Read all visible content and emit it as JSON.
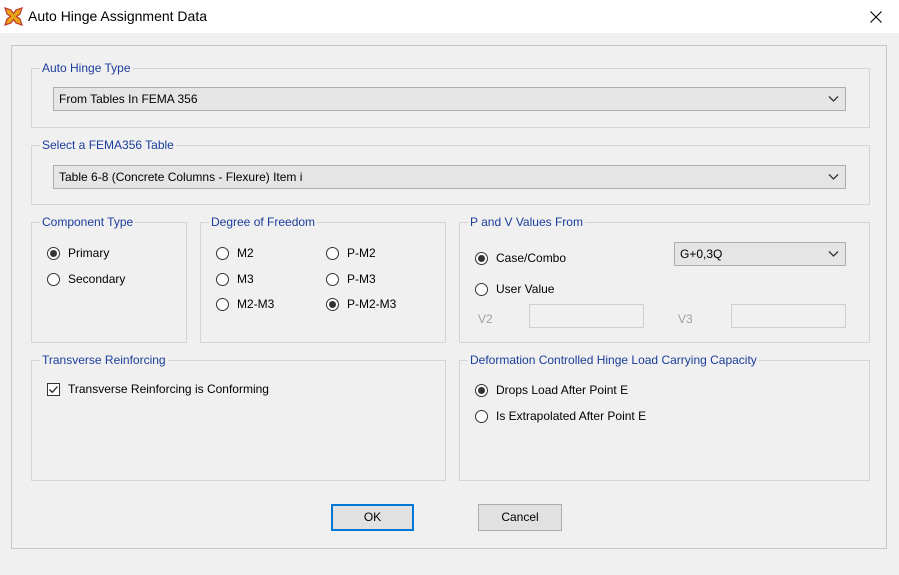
{
  "window": {
    "title": "Auto Hinge Assignment Data"
  },
  "auto_hinge_type": {
    "label": "Auto Hinge Type",
    "value": "From Tables In FEMA 356"
  },
  "fema_table": {
    "label": "Select a FEMA356 Table",
    "value": "Table 6-8 (Concrete Columns - Flexure) Item i"
  },
  "component_type": {
    "label": "Component Type",
    "options": [
      "Primary",
      "Secondary"
    ],
    "selected": "Primary"
  },
  "degree_of_freedom": {
    "label": "Degree of Freedom",
    "options": [
      "M2",
      "M3",
      "M2-M3",
      "P-M2",
      "P-M3",
      "P-M2-M3"
    ],
    "selected": "P-M2-M3"
  },
  "pv_values": {
    "label": "P and V Values From",
    "case_combo_label": "Case/Combo",
    "user_value_label": "User Value",
    "selected": "Case/Combo",
    "case_combo_value": "G+0,3Q",
    "v2_label": "V2",
    "v3_label": "V3"
  },
  "transverse": {
    "label": "Transverse Reinforcing",
    "checkbox_label": "Transverse Reinforcing is Conforming",
    "checked": true
  },
  "deformation": {
    "label": "Deformation Controlled Hinge Load Carrying Capacity",
    "option_drops": "Drops Load After Point E",
    "option_extrapolated": "Is Extrapolated After Point E",
    "selected": "Drops Load After Point E"
  },
  "buttons": {
    "ok": "OK",
    "cancel": "Cancel"
  },
  "colors": {
    "accent": "#0078d7",
    "group_label": "#1a3c9c"
  }
}
